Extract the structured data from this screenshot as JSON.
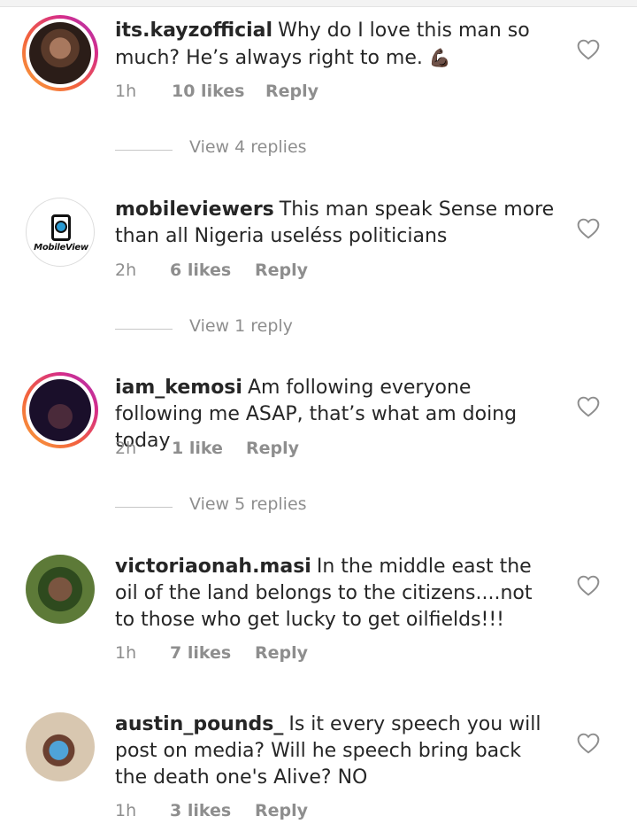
{
  "comments": [
    {
      "username": "its.kayzofficial",
      "text": "Why do I love this man so much? He’s always right to me.",
      "emoji": "💪🏿",
      "time": "1h",
      "likes": "10 likes",
      "reply": "Reply",
      "view_replies": "View 4 replies",
      "avatar": "profile-photo-man",
      "story_ring": true
    },
    {
      "username": "mobileviewers",
      "text": "This man speak Sense more than all Nigeria useléss politicians",
      "time": "2h",
      "likes": "6 likes",
      "reply": "Reply",
      "view_replies": "View 1 reply",
      "avatar": "mobileview-logo",
      "avatar_text": "MobileView",
      "story_ring": false
    },
    {
      "username": "iam_kemosi",
      "text": "Am following everyone following me ASAP, that’s what am doing today",
      "time": "2h",
      "likes": "1 like",
      "reply": "Reply",
      "view_replies": "View 5 replies",
      "avatar": "profile-photo-woman",
      "story_ring": true
    },
    {
      "username": "victoriaonah.masi",
      "text": "In the middle east the oil of the land belongs to the citizens....not to those who get lucky to get oilfields!!!",
      "time": "1h",
      "likes": "7 likes",
      "reply": "Reply",
      "avatar": "profile-photo-woman-outdoor",
      "story_ring": false
    },
    {
      "username": "austin_pounds_",
      "text": "Is it every speech you will post on media? Will he speech bring back the death one's Alive? NO",
      "time": "1h",
      "likes": "3 likes",
      "reply": "Reply",
      "avatar": "profile-photo-man-outdoor",
      "story_ring": false
    }
  ],
  "icons": {
    "like": "heart-outline-icon"
  },
  "colors": {
    "text": "#262626",
    "muted": "#8e8e8e",
    "story_ring_start": "#f9a33a",
    "story_ring_end": "#a43ab8"
  }
}
